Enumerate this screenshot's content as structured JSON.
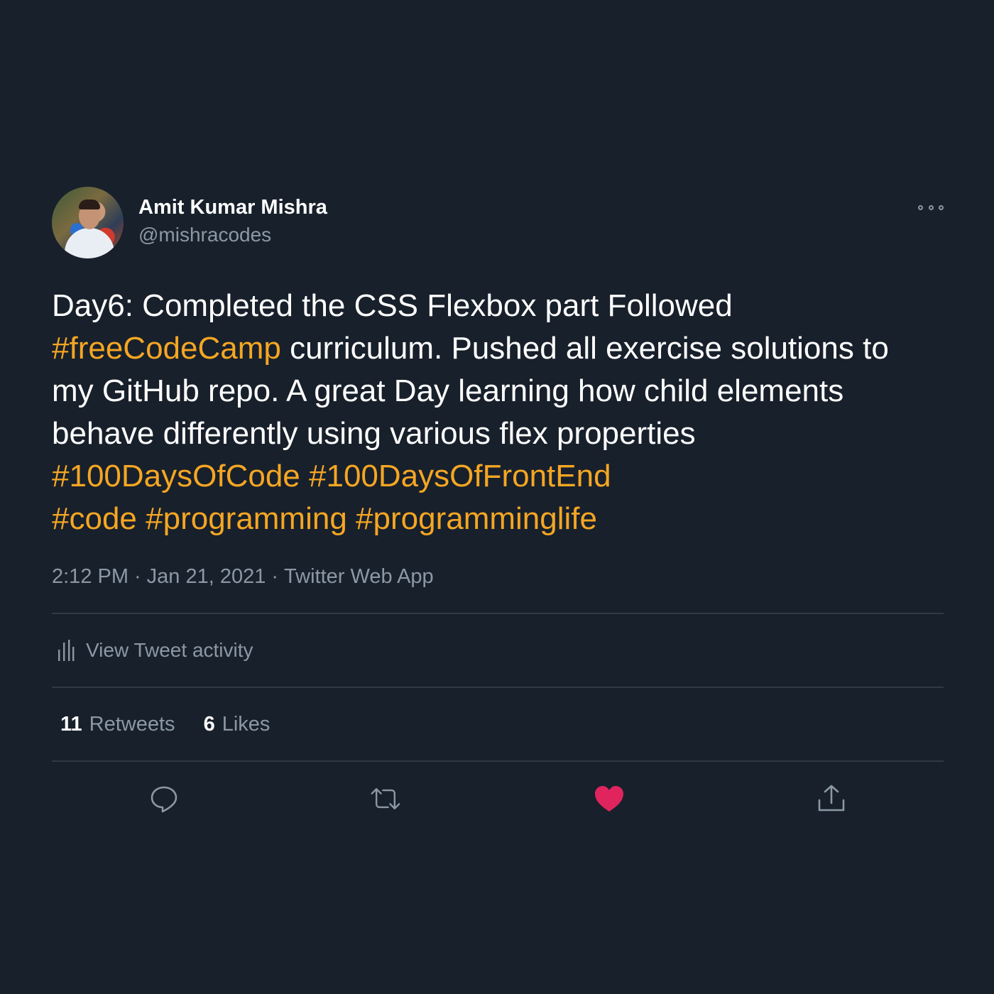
{
  "tweet": {
    "author_name": "Amit Kumar Mishra",
    "author_handle": "@mishracodes",
    "text_parts": [
      {
        "t": "Day6: Completed the CSS Flexbox part Followed "
      },
      {
        "t": "#freeCodeCamp",
        "tag": true
      },
      {
        "t": " curriculum. Pushed all exercise solutions to my GitHub repo. A great Day learning how child elements behave differently using various flex properties "
      },
      {
        "t": "#100DaysOfCode",
        "tag": true
      },
      {
        "t": " "
      },
      {
        "t": "#100DaysOfFrontEnd",
        "tag": true
      },
      {
        "t": " "
      },
      {
        "t": "#code",
        "tag": true
      },
      {
        "t": " "
      },
      {
        "t": "#programming",
        "tag": true
      },
      {
        "t": " "
      },
      {
        "t": "#programminglife",
        "tag": true
      }
    ],
    "time": "2:12 PM",
    "date": "Jan 21, 2021",
    "source": "Twitter Web App",
    "separator": "·"
  },
  "activity": {
    "label": "View Tweet activity",
    "icon": "bar-chart-icon"
  },
  "stats": {
    "retweets_count": "11",
    "retweets_label": "Retweets",
    "likes_count": "6",
    "likes_label": "Likes"
  },
  "actions": {
    "reply_icon": "reply-icon",
    "retweet_icon": "retweet-icon",
    "like_icon": "heart-icon",
    "share_icon": "share-icon"
  },
  "colors": {
    "background": "#18202b",
    "hashtag": "#f5a623",
    "like": "#e0245e",
    "muted": "#8b98a5"
  }
}
